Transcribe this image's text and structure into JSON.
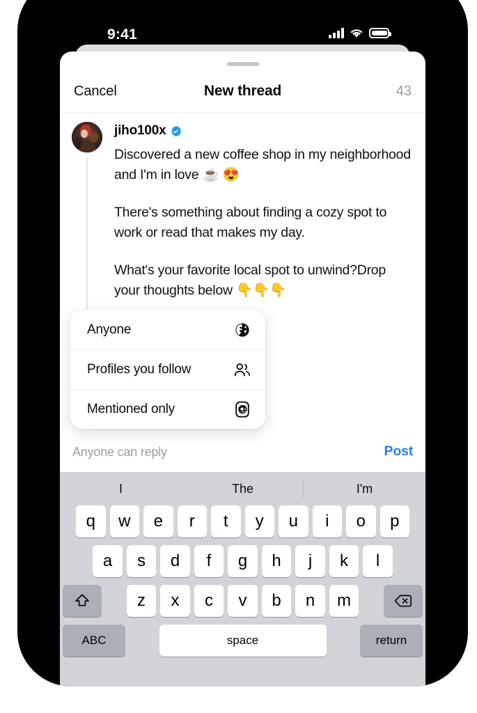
{
  "status_bar": {
    "time": "9:41",
    "icons": [
      "signal-icon",
      "wifi-icon",
      "battery-icon"
    ]
  },
  "nav": {
    "cancel_label": "Cancel",
    "title": "New thread",
    "char_count": "43"
  },
  "post": {
    "username": "jiho100x",
    "verified": true,
    "paragraphs": [
      "Discovered a new coffee shop in my neighborhood and I'm in love ☕ 😍",
      "There's something about finding a cozy spot to work or read that makes my day.",
      "What's your favorite local spot to unwind?Drop your thoughts below 👇👇👇"
    ]
  },
  "audience_menu": {
    "items": [
      {
        "label": "Anyone",
        "icon": "globe-icon"
      },
      {
        "label": "Profiles you follow",
        "icon": "people-icon"
      },
      {
        "label": "Mentioned only",
        "icon": "at-mention-icon"
      }
    ]
  },
  "reply_bar": {
    "audience_text": "Anyone can reply",
    "post_label": "Post",
    "post_color": "#2a7fdd"
  },
  "keyboard": {
    "suggestions": [
      "I",
      "The",
      "I'm"
    ],
    "row1": [
      "q",
      "w",
      "e",
      "r",
      "t",
      "y",
      "u",
      "i",
      "o",
      "p"
    ],
    "row2": [
      "a",
      "s",
      "d",
      "f",
      "g",
      "h",
      "j",
      "k",
      "l"
    ],
    "row3": [
      "z",
      "x",
      "c",
      "v",
      "b",
      "n",
      "m"
    ],
    "shift_icon": "shift-icon",
    "backspace_icon": "backspace-icon",
    "abc_label": "ABC",
    "space_label": "space",
    "return_label": "return"
  }
}
